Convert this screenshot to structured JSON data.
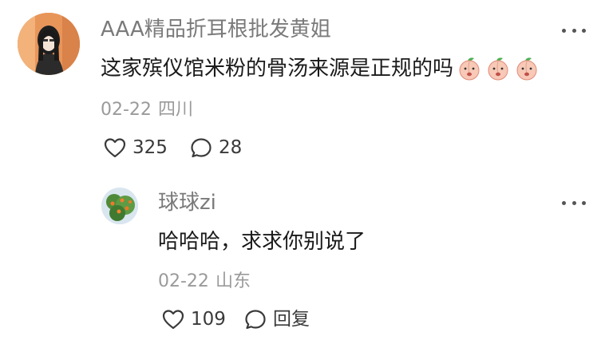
{
  "comments": [
    {
      "username": "AAA精品折耳根批发黄姐",
      "text": "这家殡仪馆米粉的骨汤来源是正规的吗",
      "emoji_count_note": "peach-face-emoji",
      "date": "02-22",
      "location": "四川",
      "likes": "325",
      "replies": "28"
    },
    {
      "username": "球球zi",
      "text": "哈哈哈，求求你别说了",
      "date": "02-22",
      "location": "山东",
      "likes": "109",
      "reply_label": "回复"
    }
  ],
  "icons": {
    "like": "heart-outline-icon",
    "comment": "speech-bubble-icon",
    "more": "more-horizontal-icon",
    "emoji": "peach-face-emoji"
  },
  "colors": {
    "text": "#1a1a1a",
    "secondary": "#7a7a7a",
    "meta": "#9a9a9a",
    "icon": "#3a3a3a"
  }
}
